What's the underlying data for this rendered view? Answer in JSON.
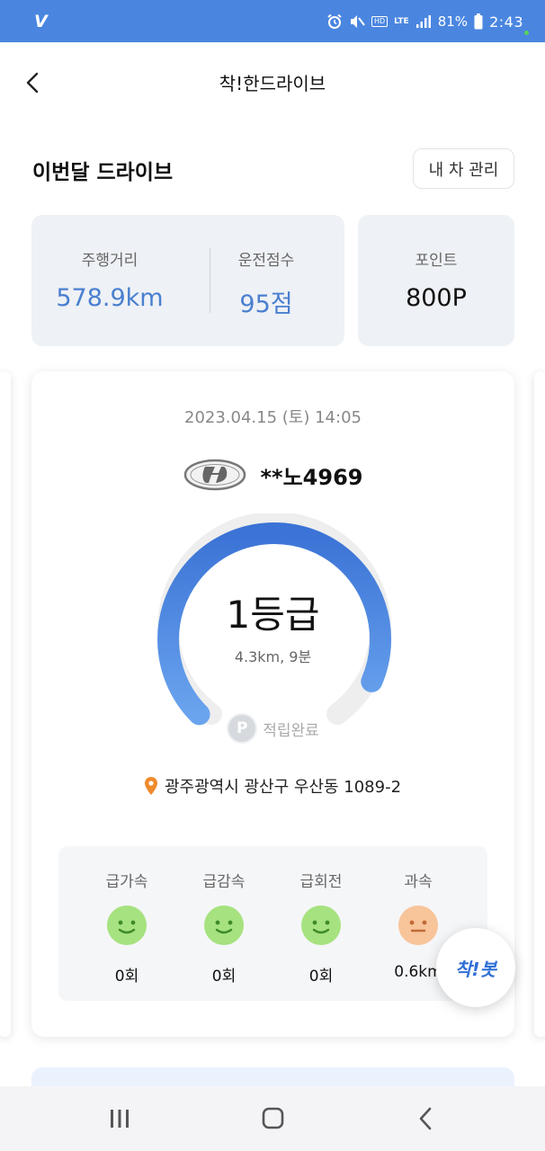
{
  "status_bar": {
    "carrier": "V",
    "hd_badge": "HD",
    "network": "LTE",
    "battery": "81%",
    "time": "2:43",
    "icons": [
      "alarm-icon",
      "mute-icon",
      "signal-icon",
      "battery-icon"
    ]
  },
  "header": {
    "title": "착!한드라이브",
    "back_icon": "chevron-left-icon"
  },
  "monthly": {
    "title": "이번달 드라이브",
    "my_car_button": "내 차 관리",
    "distance_label": "주행거리",
    "distance_value": "578.9km",
    "score_label": "운전점수",
    "score_value": "95점",
    "points_label": "포인트",
    "points_value": "800P"
  },
  "drive": {
    "datetime": "2023.04.15 (토) 14:05",
    "car_logo": "hyundai-logo-icon",
    "plate": "**노4969",
    "grade": "1등급",
    "summary": "4.3km, 9분",
    "points_badge": "P",
    "points_status": "적립완료",
    "address": "광주광역시 광산구 우산동 1089-2",
    "gauge_fraction": 0.92,
    "events": [
      {
        "label": "급가속",
        "value": "0회",
        "mood": "happy"
      },
      {
        "label": "급감속",
        "value": "0회",
        "mood": "happy"
      },
      {
        "label": "급회전",
        "value": "0회",
        "mood": "happy"
      },
      {
        "label": "과속",
        "value": "0.6km",
        "mood": "neutral"
      }
    ]
  },
  "chatbot": {
    "label": "착!봇"
  },
  "colors": {
    "status_bar": "#4a86e0",
    "accent_blue": "#4a7fd0",
    "gauge_start": "#3b73d6",
    "gauge_end": "#6aa4ee",
    "happy_face": "#a6e27f",
    "neutral_face": "#f8c49a",
    "pin_orange": "#f08a2c"
  }
}
